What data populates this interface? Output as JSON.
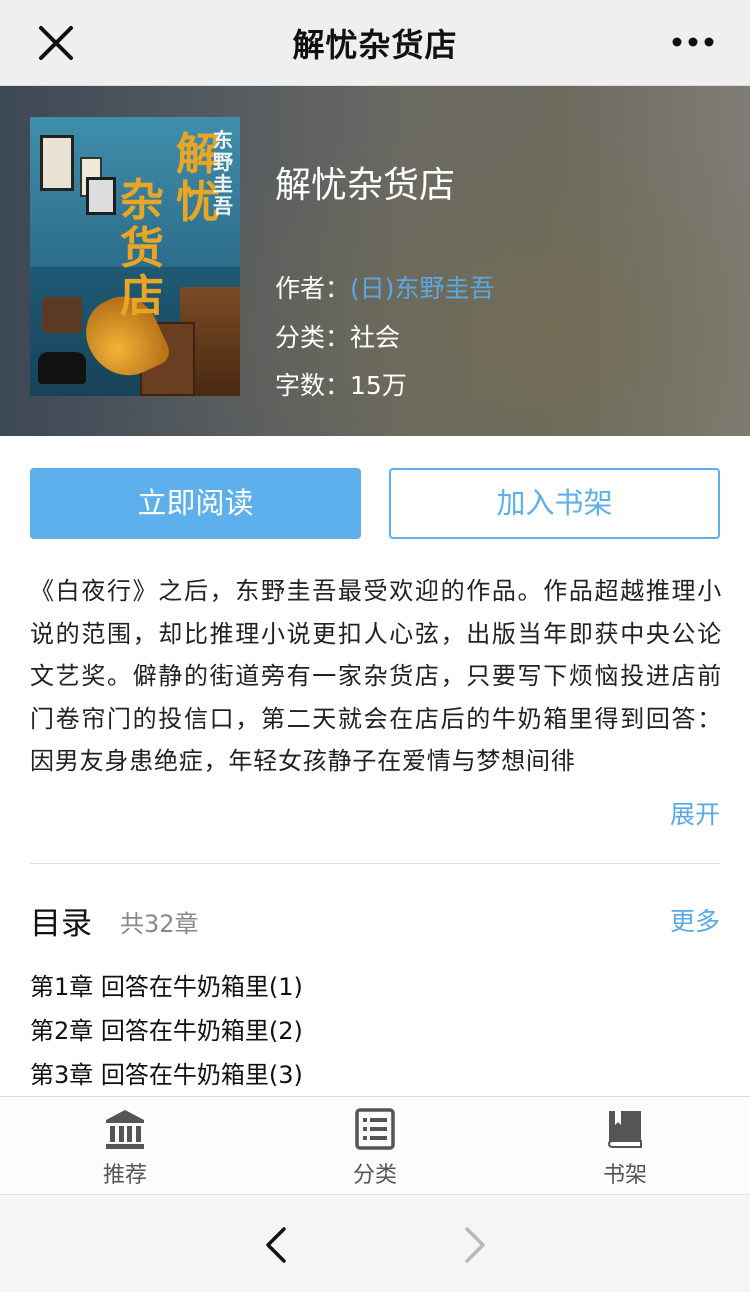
{
  "topbar": {
    "title": "解忧杂货店",
    "close_icon": "close-icon",
    "more_icon": "more-dots-icon"
  },
  "book": {
    "title": "解忧杂货店",
    "cover": {
      "title_chars": [
        "解忧",
        "杂货店"
      ],
      "author_chars": "东野圭吾"
    },
    "author_label": "作者：",
    "author": "(日)东野圭吾",
    "category_label": "分类：",
    "category": "社会",
    "words_label": "字数：",
    "words": "15万"
  },
  "actions": {
    "read_label": "立即阅读",
    "shelf_label": "加入书架"
  },
  "description": {
    "text": "《白夜行》之后，东野圭吾最受欢迎的作品。作品超越推理小说的范围，却比推理小说更扣人心弦，出版当年即获中央公论文艺奖。僻静的街道旁有一家杂货店，只要写下烦恼投进店前门卷帘门的投信口，第二天就会在店后的牛奶箱里得到回答：因男友身患绝症，年轻女孩静子在爱情与梦想间徘",
    "expand_label": "展开"
  },
  "toc": {
    "title": "目录",
    "count": "共32章",
    "more_label": "更多",
    "chapters": [
      "第1章  回答在牛奶箱里(1)",
      "第2章  回答在牛奶箱里(2)",
      "第3章  回答在牛奶箱里(3)"
    ],
    "ellipsis": "......"
  },
  "tabbar": {
    "items": [
      {
        "label": "推荐",
        "icon": "bank-icon"
      },
      {
        "label": "分类",
        "icon": "list-icon"
      },
      {
        "label": "书架",
        "icon": "book-icon"
      }
    ]
  },
  "navbar": {
    "back_icon": "chevron-left-icon",
    "forward_icon": "chevron-right-icon"
  },
  "colors": {
    "accent": "#5db0ec",
    "link": "#5aa8e6"
  }
}
